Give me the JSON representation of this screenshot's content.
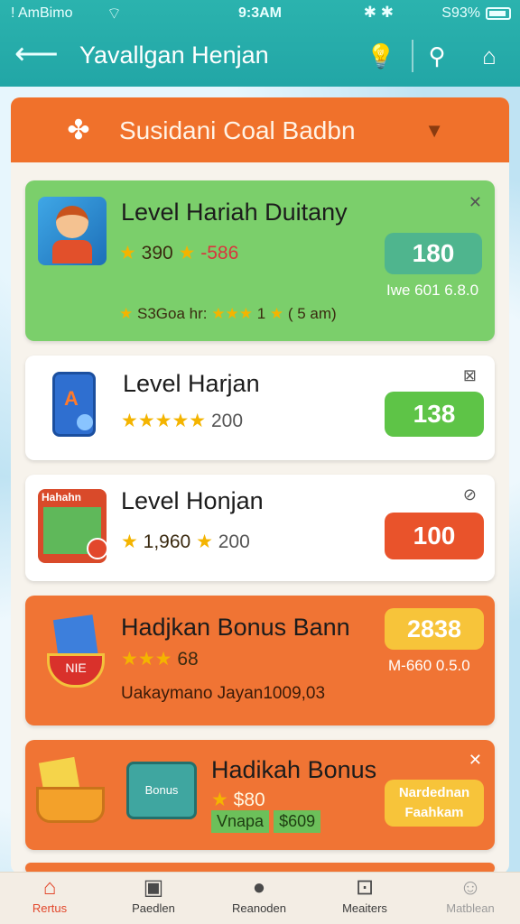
{
  "status": {
    "carrier": "! AmBimo",
    "time": "9:3AM",
    "battery": "S93%"
  },
  "header": {
    "title": "Yavallgan Henjan"
  },
  "icons": {
    "back": "back-arrow-icon",
    "bulb": "lightbulb-icon",
    "search": "search-icon",
    "shop": "shop-icon"
  },
  "dropdown": {
    "label": "Susidani Coal Badbn"
  },
  "cards": [
    {
      "title": "Level Hariah Duitany",
      "stat_a": "390",
      "stat_b": "-586",
      "stat_c": "S3Goa hr:",
      "stat_d": "1",
      "stat_e": "( 5 am)",
      "button": "180",
      "note": "Iwe 601 6.8.0"
    },
    {
      "title": "Level Harjan",
      "stat_a": "200",
      "button": "138"
    },
    {
      "title": "Level Honjan",
      "thumb_text": "Hahahn",
      "stat_a": "1,960",
      "stat_b": "200",
      "button": "100"
    },
    {
      "title": "Hadjkan Bonus Bann",
      "stat_a": "68",
      "badge_text": "NIE",
      "stat_b": "Uakaymano Jayan1009,03",
      "button": "2838",
      "note": "M-660 0.5.0"
    },
    {
      "title": "Hadikah Bonus",
      "chest_text": "Bonus",
      "stat_a": "$80",
      "tag_a": "Vnapa",
      "tag_b": "$609",
      "button_1": "Nardednan",
      "button_2": "Faahkam"
    }
  ],
  "nav": [
    {
      "label": "Rertus",
      "icon": "home-icon"
    },
    {
      "label": "Paedlen",
      "icon": "box-icon"
    },
    {
      "label": "Reanoden",
      "icon": "chat-bubble-icon"
    },
    {
      "label": "Meaiters",
      "icon": "briefcase-icon"
    },
    {
      "label": "Matblean",
      "icon": "profile-icon"
    }
  ],
  "colors": {
    "header": "#22a6a6",
    "orange": "#f0712b",
    "green": "#7bcf6b",
    "red_btn": "#e9532b"
  }
}
